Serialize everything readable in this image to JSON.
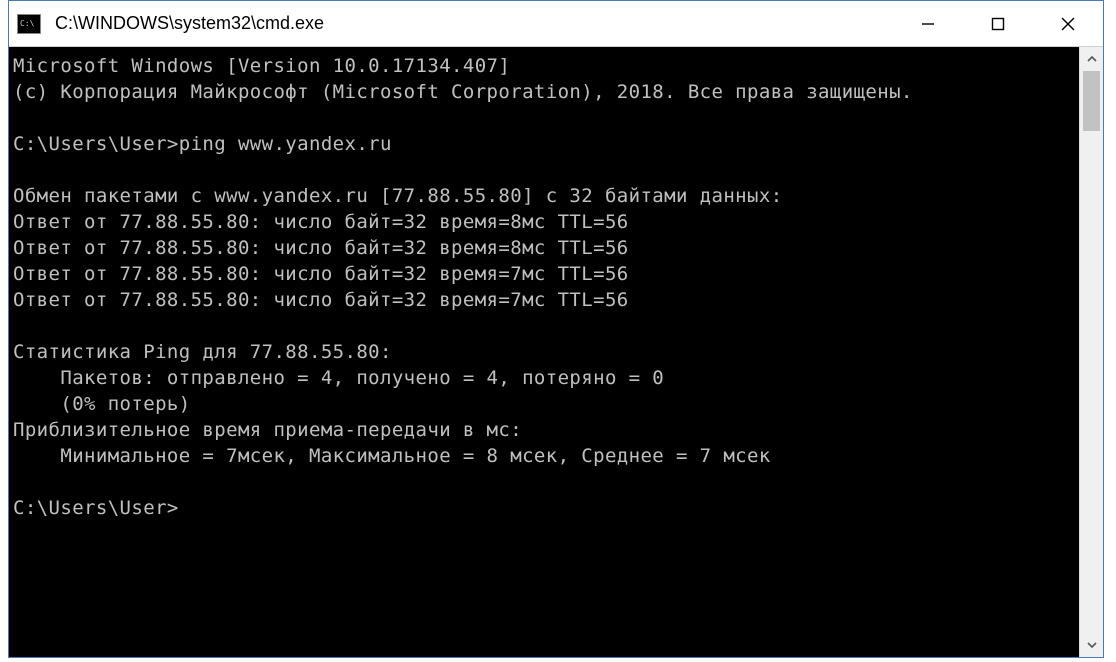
{
  "window": {
    "title": "C:\\WINDOWS\\system32\\cmd.exe"
  },
  "terminal": {
    "lines": [
      "Microsoft Windows [Version 10.0.17134.407]",
      "(c) Корпорация Майкрософт (Microsoft Corporation), 2018. Все права защищены.",
      "",
      "C:\\Users\\User>ping www.yandex.ru",
      "",
      "Обмен пакетами с www.yandex.ru [77.88.55.80] с 32 байтами данных:",
      "Ответ от 77.88.55.80: число байт=32 время=8мс TTL=56",
      "Ответ от 77.88.55.80: число байт=32 время=8мс TTL=56",
      "Ответ от 77.88.55.80: число байт=32 время=7мс TTL=56",
      "Ответ от 77.88.55.80: число байт=32 время=7мс TTL=56",
      "",
      "Статистика Ping для 77.88.55.80:",
      "    Пакетов: отправлено = 4, получено = 4, потеряно = 0",
      "    (0% потерь)",
      "Приблизительное время приема-передачи в мс:",
      "    Минимальное = 7мсек, Максимальное = 8 мсек, Среднее = 7 мсек",
      "",
      "C:\\Users\\User>"
    ]
  }
}
